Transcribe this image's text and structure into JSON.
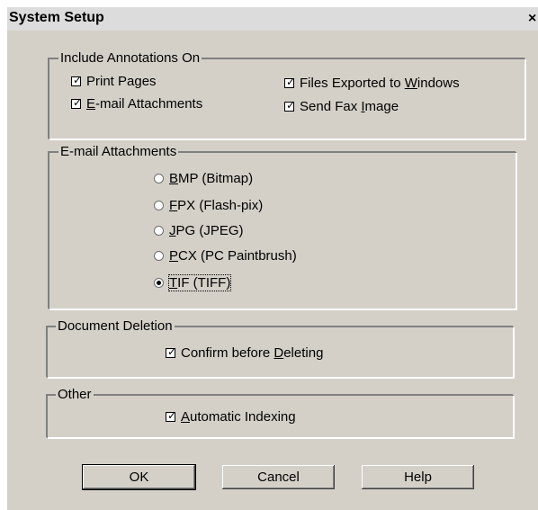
{
  "window": {
    "title": "System Setup",
    "close_glyph": "×"
  },
  "annotations": {
    "legend": "Include Annotations On",
    "options": [
      {
        "pre": "Print Pa",
        "key": "g",
        "post": "es",
        "checked": true
      },
      {
        "pre": "",
        "key": "E",
        "post": "-mail Attachments",
        "checked": true
      },
      {
        "pre": "Files Exported to ",
        "key": "W",
        "post": "indows",
        "checked": true
      },
      {
        "pre": "Send Fax ",
        "key": "I",
        "post": "mage",
        "checked": true
      }
    ]
  },
  "email": {
    "legend": "E-mail Attachments",
    "options": [
      {
        "pre": "",
        "key": "B",
        "post": "MP (Bitmap)",
        "selected": false
      },
      {
        "pre": "",
        "key": "F",
        "post": "PX (Flash-pix)",
        "selected": false
      },
      {
        "pre": "",
        "key": "J",
        "post": "PG (JPEG)",
        "selected": false
      },
      {
        "pre": "",
        "key": "P",
        "post": "CX (PC Paintbrush)",
        "selected": false
      },
      {
        "pre": "",
        "key": "T",
        "post": "IF (TIFF)",
        "selected": true
      }
    ]
  },
  "deletion": {
    "legend": "Document Deletion",
    "confirm": {
      "pre": "Confirm before ",
      "key": "D",
      "post": "eleting",
      "checked": true
    }
  },
  "other": {
    "legend": "Other",
    "indexing": {
      "pre": "",
      "key": "A",
      "post": "utomatic Indexing",
      "checked": true
    }
  },
  "buttons": {
    "ok": "OK",
    "cancel": "Cancel",
    "help": "Help"
  }
}
